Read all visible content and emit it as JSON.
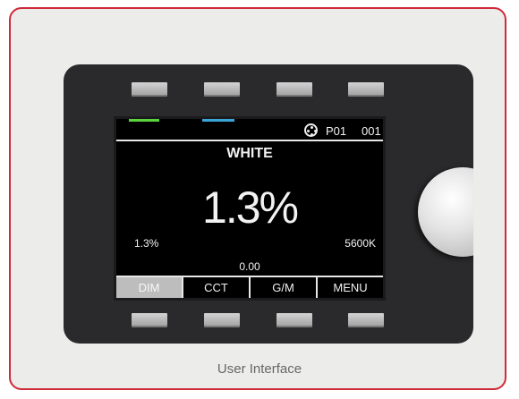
{
  "screen": {
    "profile": "P01",
    "channel": "001",
    "mode_title": "WHITE",
    "main_value": "1.3%",
    "dim_value": "1.3%",
    "cct_value": "5600K",
    "gm_value": "0.00",
    "softkeys": [
      {
        "label": "DIM",
        "active": true
      },
      {
        "label": "CCT",
        "active": false
      },
      {
        "label": "G/M",
        "active": false
      },
      {
        "label": "MENU",
        "active": false
      }
    ],
    "icons": {
      "dmx": "dmx-connector-icon"
    },
    "colors": {
      "accent_green": "#59d63c",
      "accent_blue": "#3aa6d8",
      "frame": "#cf2a3a"
    }
  },
  "caption": "User Interface"
}
